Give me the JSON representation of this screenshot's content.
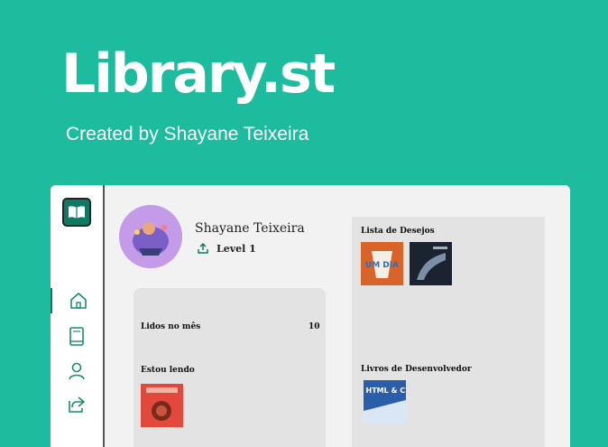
{
  "hero": {
    "title": "Library.st",
    "subtitle": "Created by Shayane Teixeira"
  },
  "sidebar": {
    "logo_icon": "book-open-icon",
    "items": [
      {
        "icon": "home-icon",
        "active": true
      },
      {
        "icon": "book-icon",
        "active": false
      },
      {
        "icon": "user-icon",
        "active": false
      },
      {
        "icon": "share-icon",
        "active": false
      }
    ]
  },
  "profile": {
    "name": "Shayane Teixeira",
    "level": "Level 1"
  },
  "stats": {
    "read_month_label": "Lidos no mês",
    "read_month_value": "10",
    "reading_label": "Estou lendo"
  },
  "wishlist": {
    "title": "Lista de Desejos",
    "books": [
      {
        "cover_text": "UM DIA",
        "color": "#d8642a"
      },
      {
        "cover_text": "",
        "color": "#1b2330"
      }
    ]
  },
  "dev_books": {
    "title": "Livros de Desenvolvedor",
    "books": [
      {
        "cover_text": "HTML & CSS",
        "color": "#2a5ea8"
      }
    ]
  },
  "reading_books": [
    {
      "cover_text": "",
      "color": "#e2483c"
    }
  ],
  "colors": {
    "accent": "#1ebc9e",
    "dark_green": "#0f7a63",
    "panel": "#e3e3e3"
  }
}
